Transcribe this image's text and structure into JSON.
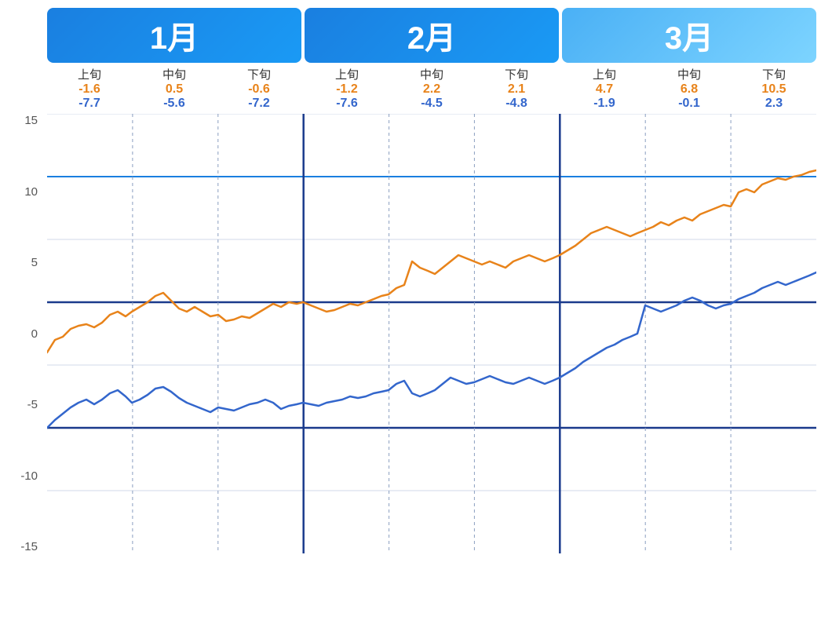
{
  "months": [
    {
      "label": "1月",
      "color_start": "#1a7fe0",
      "color_end": "#1a7fe0",
      "width_ratio": 0.333,
      "periods": [
        {
          "name": "上旬",
          "orange": "-1.6",
          "blue": "-7.7"
        },
        {
          "name": "中旬",
          "orange": "0.5",
          "blue": "-5.6"
        },
        {
          "name": "下旬",
          "orange": "-0.6",
          "blue": "-7.2"
        }
      ]
    },
    {
      "label": "2月",
      "color_start": "#1a7fe0",
      "color_end": "#1a7fe0",
      "width_ratio": 0.333,
      "periods": [
        {
          "name": "上旬",
          "orange": "-1.2",
          "blue": "-7.6"
        },
        {
          "name": "中旬",
          "orange": "2.2",
          "blue": "-4.5"
        },
        {
          "name": "下旬",
          "orange": "2.1",
          "blue": "-4.8"
        }
      ]
    },
    {
      "label": "3月",
      "color_start": "#4ab0f5",
      "color_end": "#4ab0f5",
      "width_ratio": 0.333,
      "periods": [
        {
          "name": "上旬",
          "orange": "4.7",
          "blue": "-1.9"
        },
        {
          "name": "中旬",
          "orange": "6.8",
          "blue": "-0.1"
        },
        {
          "name": "下旬",
          "orange": "10.5",
          "blue": "2.3"
        }
      ]
    }
  ],
  "y_labels": [
    "15",
    "10",
    "5",
    "0",
    "-5",
    "-10",
    "-15"
  ],
  "y_values": [
    15,
    10,
    5,
    0,
    -5,
    -10,
    -15
  ]
}
